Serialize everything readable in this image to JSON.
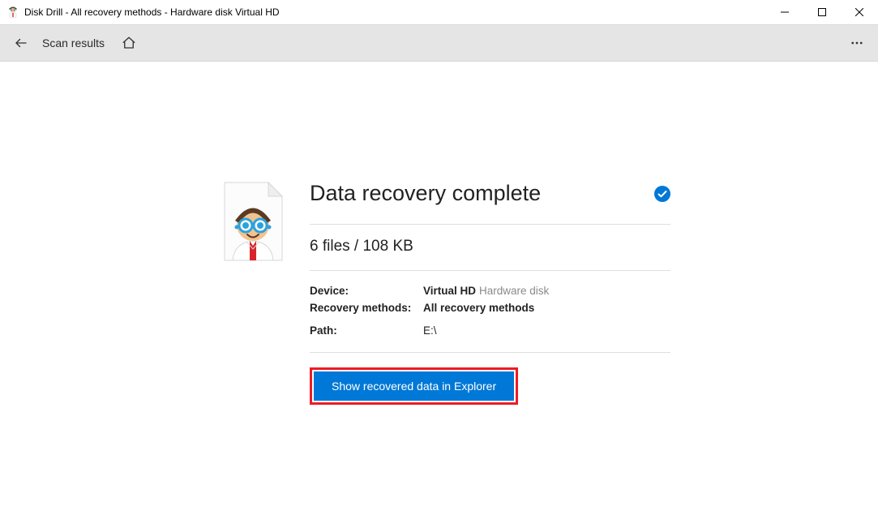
{
  "window": {
    "title": "Disk Drill - All recovery methods - Hardware disk Virtual HD"
  },
  "toolbar": {
    "breadcrumb": "Scan results"
  },
  "result": {
    "heading": "Data recovery complete",
    "file_count": "6 files / 108 KB",
    "labels": {
      "device": "Device:",
      "recovery_methods": "Recovery methods:",
      "path": "Path:"
    },
    "values": {
      "device_name": "Virtual HD",
      "device_kind": "Hardware disk",
      "recovery_methods": "All recovery methods",
      "path": "E:\\"
    }
  },
  "actions": {
    "show_in_explorer": "Show recovered data in Explorer"
  }
}
